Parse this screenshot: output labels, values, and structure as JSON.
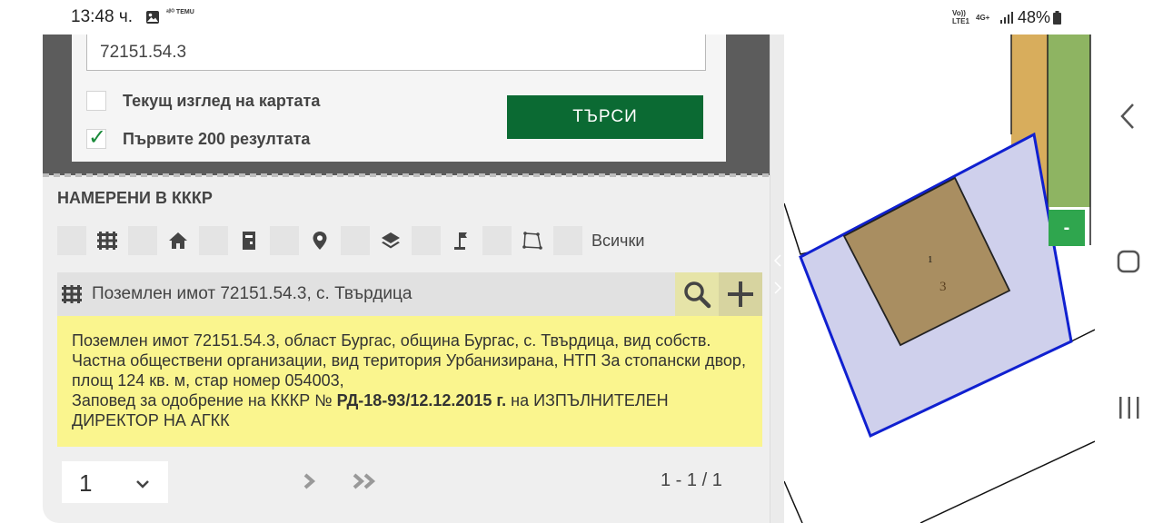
{
  "status_bar": {
    "time": "13:48 ч.",
    "temu_label": "ᵃᵝᴼ TEMU",
    "volte_label": "Vo)) LTE1",
    "network_label": "4G+",
    "battery_percent": "48%"
  },
  "search": {
    "query": "72151.54.3",
    "option_current_view": {
      "label": "Текущ изглед на картата",
      "checked": false
    },
    "option_first_200": {
      "label": "Първите 200 резултата",
      "checked": true
    },
    "button_label": "ТЪРСИ",
    "button_color": "#0b6a33"
  },
  "results": {
    "heading": "НАМЕРЕНИ В КККР",
    "filters": [
      "grid-icon",
      "house-icon",
      "building-icon",
      "pin-icon",
      "layers-icon",
      "flag-icon",
      "polygon-icon"
    ],
    "filter_all_label": "Всички",
    "item": {
      "title": "Поземлен имот 72151.54.3, с. Твърдица",
      "description_line1": "Поземлен имот 72151.54.3, област Бургас, община Бургас, с. Твърдица, вид собств. Частна обществени организации, вид територия Урбанизирана, НТП За стопански двор, площ 124 кв. м, стар номер 054003,",
      "order_prefix": "Заповед за одобрение на КККР №",
      "order_number": "РД-18-93/12.12.2015 г.",
      "order_suffix": "на ИЗПЪЛНИТЕЛЕН ДИРЕКТОР НА АГКК",
      "highlight_color": "#faf58e"
    },
    "pager": {
      "page": "1",
      "count_label": "1 - 1 / 1"
    }
  },
  "map": {
    "building_label": "1",
    "parcel_label": "3",
    "zoom_out_label": "-",
    "parcel_fill": "#cfd0ec",
    "parcel_stroke": "#1020d0",
    "building_fill": "#a98e61",
    "strip_orange": "#d8ad5c",
    "strip_green": "#8eb462"
  }
}
